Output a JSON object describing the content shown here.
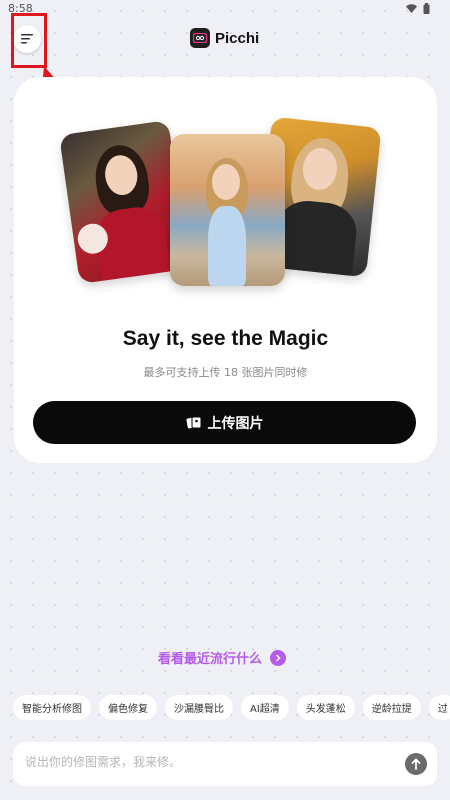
{
  "status_bar": {
    "time": "8:58",
    "icons": [
      "wifi-icon",
      "battery-icon"
    ]
  },
  "header": {
    "brand_name": "Picchi",
    "menu_icon": "menu-icon",
    "logo_icon": "picchi-logo-icon"
  },
  "annotation": {
    "color": "#e0161e"
  },
  "hero_card": {
    "headline": "Say it, see the Magic",
    "subline": "最多可支持上传 18 张图片同时修",
    "upload_button_label": "上传图片",
    "upload_icon": "photos-icon"
  },
  "trending": {
    "label": "看看最近流行什么",
    "icon": "chevron-right-circle-icon"
  },
  "chips": [
    {
      "label": "智能分析修图"
    },
    {
      "label": "偏色修复"
    },
    {
      "label": "沙漏腰臀比"
    },
    {
      "label": "AI超清"
    },
    {
      "label": "头发蓬松"
    },
    {
      "label": "逆龄拉提"
    },
    {
      "label": "过"
    }
  ],
  "input": {
    "placeholder": "说出你的修图需求，我来修。",
    "value": ""
  },
  "colors": {
    "accent": "#b65ce8",
    "button_bg": "#0a0a0a",
    "page_bg": "#eef0f5"
  }
}
